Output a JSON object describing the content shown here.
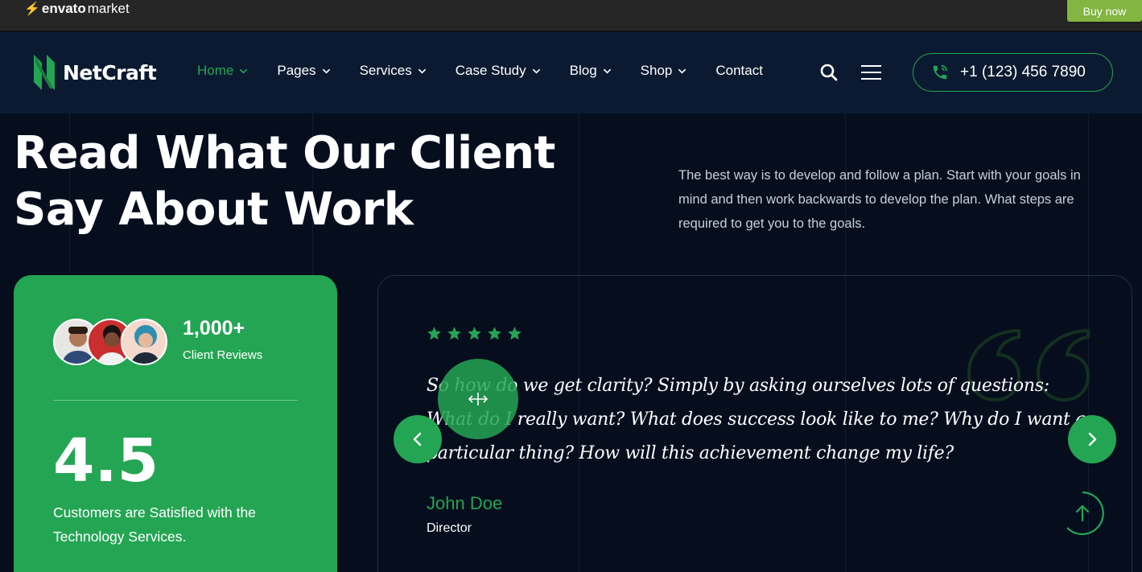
{
  "envato": {
    "logo_text": "envato",
    "logo_suffix": "market",
    "buy_now": "Buy now"
  },
  "header": {
    "brand": "NetCraft",
    "nav": [
      {
        "label": "Home",
        "dropdown": true,
        "active": true
      },
      {
        "label": "Pages",
        "dropdown": true
      },
      {
        "label": "Services",
        "dropdown": true
      },
      {
        "label": "Case Study",
        "dropdown": true
      },
      {
        "label": "Blog",
        "dropdown": true
      },
      {
        "label": "Shop",
        "dropdown": true
      },
      {
        "label": "Contact",
        "dropdown": false
      }
    ],
    "phone": "+1 (123) 456 7890"
  },
  "section": {
    "title_line1": "Read What Our Client",
    "title_line2": "Say About Work",
    "description": "The best way is to develop and follow a plan. Start with your goals in mind and then work backwards to develop the plan. What steps are required to get you to the goals."
  },
  "stats_card": {
    "reviews_count": "1,000+",
    "reviews_label": "Client Reviews",
    "rating": "4.5",
    "rating_text": "Customers are Satisfied with the Technology Services."
  },
  "testimonial": {
    "stars": 5,
    "quote": "So how do we get clarity? Simply by asking ourselves lots of questions: What do I really want? What does success look like to me? Why do I want a particular thing? How will this achievement change my life?",
    "author_name": "John Doe",
    "author_role": "Director"
  },
  "colors": {
    "accent": "#24a553",
    "background": "#060e1e",
    "header_bg": "#0b1a31",
    "envato_green": "#82b541"
  }
}
